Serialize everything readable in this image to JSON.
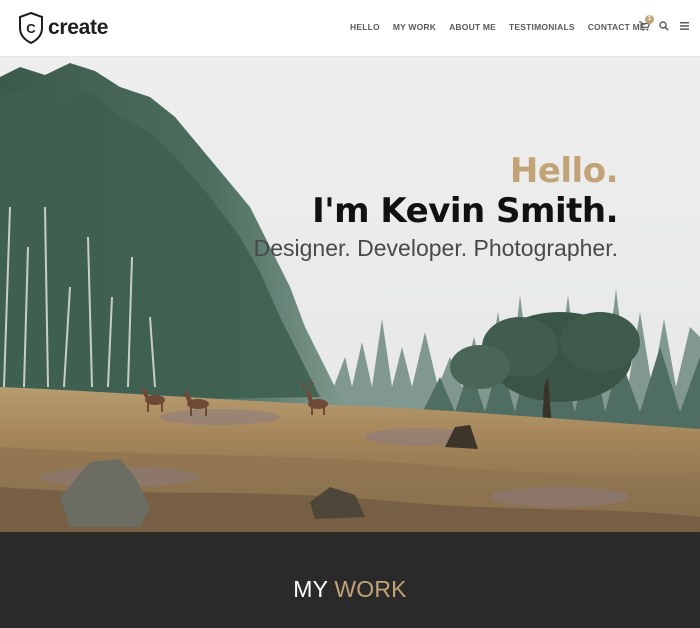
{
  "brand": {
    "logo_letter": "C",
    "name": "create"
  },
  "nav": {
    "items": [
      "HELLO",
      "MY WORK",
      "ABOUT ME",
      "TESTIMONIALS",
      "CONTACT ME"
    ]
  },
  "header_icons": {
    "cart": {
      "icon": "cart-icon",
      "badge": "1"
    },
    "search": {
      "icon": "search-icon"
    },
    "menu": {
      "icon": "menu-icon"
    }
  },
  "hero": {
    "greeting": "Hello.",
    "headline": "I'm Kevin Smith.",
    "subtitle": "Designer. Developer. Photographer."
  },
  "section": {
    "title_part1": "MY",
    "title_part2": "WORK"
  },
  "colors": {
    "accent": "#c2a377",
    "dark": "#2b2a2a",
    "header_bg": "#ffffff"
  }
}
